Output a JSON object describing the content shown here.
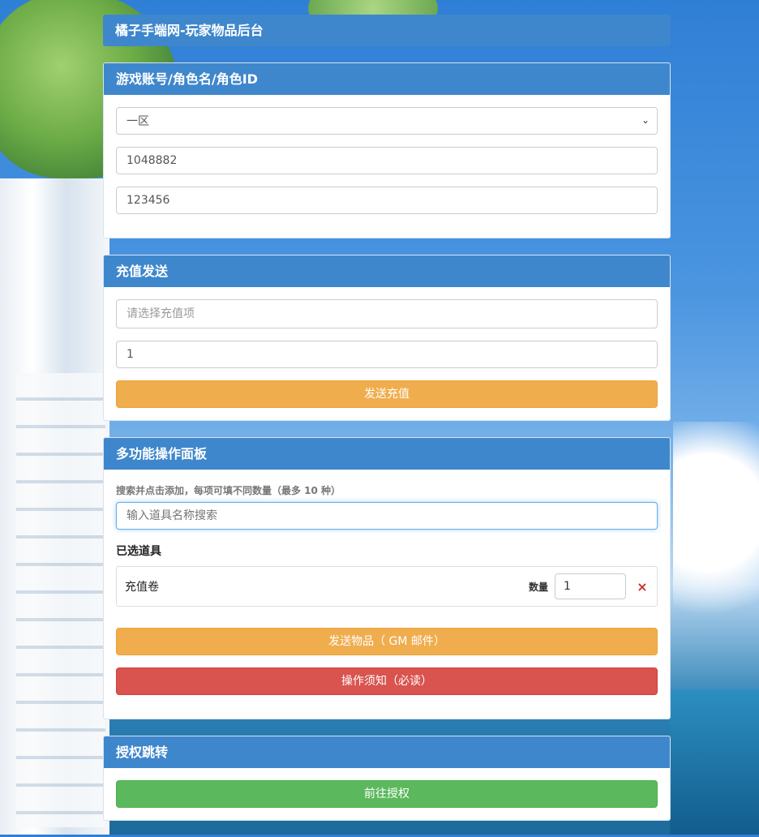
{
  "site_title": "橘子手端网-玩家物品后台",
  "account_panel": {
    "title": "游戏账号/角色名/角色ID",
    "server_select": "一区",
    "account_value": "1048882",
    "password_value": "123456"
  },
  "recharge_panel": {
    "title": "充值发送",
    "select_placeholder": "请选择充值项",
    "quantity_value": "1",
    "send_button": "发送充值"
  },
  "multi_panel": {
    "title": "多功能操作面板",
    "hint": "搜索并点击添加，每项可填不同数量（最多 10 种）",
    "search_placeholder": "输入道具名称搜索",
    "selected_title": "已选道具",
    "items": [
      {
        "name": "充值卷",
        "qty_label": "数量",
        "qty": "1",
        "remove": "×"
      }
    ],
    "send_items_button": "发送物品（ GM 邮件）",
    "notice_button": "操作须知（必读）"
  },
  "auth_panel": {
    "title": "授权跳转",
    "go_button": "前往授权"
  },
  "colors": {
    "panel_heading": "#3f87cc",
    "warning": "#f0ad4e",
    "danger": "#d9534f",
    "success": "#5cb85c"
  },
  "icons": {
    "select_arrow": "chevron-down-icon",
    "dropdown_caret": "caret-down-icon",
    "remove": "close-icon"
  }
}
